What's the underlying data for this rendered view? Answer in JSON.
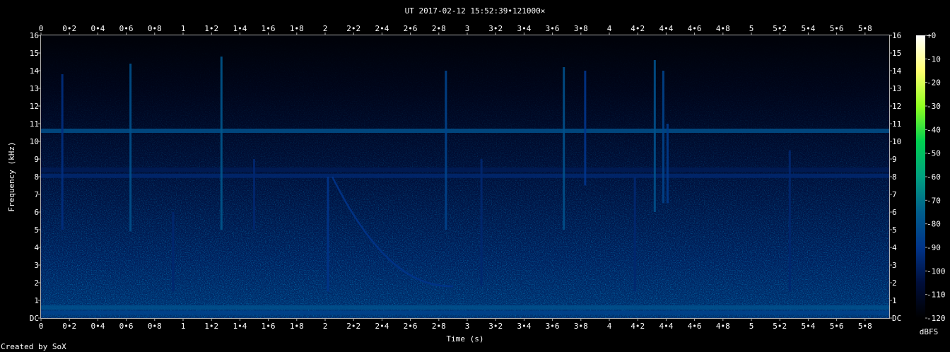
{
  "chart_data": {
    "type": "heatmap",
    "title": "UT 2017-02-12 15:52:39•121000×",
    "xlabel": "Time (s)",
    "ylabel": "Frequency (kHz)",
    "footer": "Created by SoX",
    "xlim": [
      0,
      5.97
    ],
    "ylim": [
      0,
      16
    ],
    "x_ticks": [
      {
        "v": 0,
        "label": "0"
      },
      {
        "v": 0.2,
        "label": "0•2"
      },
      {
        "v": 0.4,
        "label": "0•4"
      },
      {
        "v": 0.6,
        "label": "0•6"
      },
      {
        "v": 0.8,
        "label": "0•8"
      },
      {
        "v": 1,
        "label": "1"
      },
      {
        "v": 1.2,
        "label": "1•2"
      },
      {
        "v": 1.4,
        "label": "1•4"
      },
      {
        "v": 1.6,
        "label": "1•6"
      },
      {
        "v": 1.8,
        "label": "1•8"
      },
      {
        "v": 2,
        "label": "2"
      },
      {
        "v": 2.2,
        "label": "2•2"
      },
      {
        "v": 2.4,
        "label": "2•4"
      },
      {
        "v": 2.6,
        "label": "2•6"
      },
      {
        "v": 2.8,
        "label": "2•8"
      },
      {
        "v": 3,
        "label": "3"
      },
      {
        "v": 3.2,
        "label": "3•2"
      },
      {
        "v": 3.4,
        "label": "3•4"
      },
      {
        "v": 3.6,
        "label": "3•6"
      },
      {
        "v": 3.8,
        "label": "3•8"
      },
      {
        "v": 4,
        "label": "4"
      },
      {
        "v": 4.2,
        "label": "4•2"
      },
      {
        "v": 4.4,
        "label": "4•4"
      },
      {
        "v": 4.6,
        "label": "4•6"
      },
      {
        "v": 4.8,
        "label": "4•8"
      },
      {
        "v": 5,
        "label": "5"
      },
      {
        "v": 5.2,
        "label": "5•2"
      },
      {
        "v": 5.4,
        "label": "5•4"
      },
      {
        "v": 5.6,
        "label": "5•6"
      },
      {
        "v": 5.8,
        "label": "5•8"
      }
    ],
    "y_ticks": [
      {
        "v": 0,
        "label": "DC"
      },
      {
        "v": 1,
        "label": "1"
      },
      {
        "v": 2,
        "label": "2"
      },
      {
        "v": 3,
        "label": "3"
      },
      {
        "v": 4,
        "label": "4"
      },
      {
        "v": 5,
        "label": "5"
      },
      {
        "v": 6,
        "label": "6"
      },
      {
        "v": 7,
        "label": "7"
      },
      {
        "v": 8,
        "label": "8"
      },
      {
        "v": 9,
        "label": "9"
      },
      {
        "v": 10,
        "label": "10"
      },
      {
        "v": 11,
        "label": "11"
      },
      {
        "v": 12,
        "label": "12"
      },
      {
        "v": 13,
        "label": "13"
      },
      {
        "v": 14,
        "label": "14"
      },
      {
        "v": 15,
        "label": "15"
      },
      {
        "v": 16,
        "label": "16"
      }
    ],
    "colorbar": {
      "label": "dBFS",
      "range": [
        -120,
        0
      ],
      "ticks": [
        {
          "v": 0,
          "label": "+0"
        },
        {
          "v": -10,
          "label": "-10"
        },
        {
          "v": -20,
          "label": "-20"
        },
        {
          "v": -30,
          "label": "-30"
        },
        {
          "v": -40,
          "label": "-40"
        },
        {
          "v": -50,
          "label": "-50"
        },
        {
          "v": -60,
          "label": "-60"
        },
        {
          "v": -70,
          "label": "-70"
        },
        {
          "v": -80,
          "label": "-80"
        },
        {
          "v": -90,
          "label": "-90"
        },
        {
          "v": -100,
          "label": "-100"
        },
        {
          "v": -110,
          "label": "-110"
        },
        {
          "v": -120,
          "label": "-120"
        }
      ],
      "colors": [
        "#000000",
        "#000e3a",
        "#00348a",
        "#005e8c",
        "#00a080",
        "#00d050",
        "#90ff20",
        "#ffff70",
        "#ffffff"
      ]
    },
    "background_color": "#000f38",
    "tonal_lines": [
      {
        "freq_khz": 10.6,
        "level_dbfs": -80
      },
      {
        "freq_khz": 8.05,
        "level_dbfs": -95
      },
      {
        "freq_khz": 8.4,
        "level_dbfs": -100
      },
      {
        "freq_khz": 0.6,
        "level_dbfs": -80
      },
      {
        "freq_khz": 0.3,
        "level_dbfs": -85
      }
    ],
    "impulses": [
      {
        "t": 0.15,
        "f_lo": 5.0,
        "f_hi": 13.8,
        "level_dbfs": -92
      },
      {
        "t": 0.63,
        "f_lo": 4.9,
        "f_hi": 14.4,
        "level_dbfs": -80
      },
      {
        "t": 0.93,
        "f_lo": 1.5,
        "f_hi": 6.0,
        "level_dbfs": -95
      },
      {
        "t": 1.27,
        "f_lo": 5.0,
        "f_hi": 14.8,
        "level_dbfs": -78
      },
      {
        "t": 1.5,
        "f_lo": 5.0,
        "f_hi": 9.0,
        "level_dbfs": -95
      },
      {
        "t": 2.02,
        "f_lo": 1.5,
        "f_hi": 8.0,
        "level_dbfs": -90
      },
      {
        "t": 2.85,
        "f_lo": 5.0,
        "f_hi": 14.0,
        "level_dbfs": -85
      },
      {
        "t": 3.1,
        "f_lo": 1.8,
        "f_hi": 9.0,
        "level_dbfs": -95
      },
      {
        "t": 3.68,
        "f_lo": 5.0,
        "f_hi": 14.2,
        "level_dbfs": -80
      },
      {
        "t": 3.83,
        "f_lo": 7.5,
        "f_hi": 14.0,
        "level_dbfs": -90
      },
      {
        "t": 4.18,
        "f_lo": 1.5,
        "f_hi": 8.0,
        "level_dbfs": -95
      },
      {
        "t": 4.32,
        "f_lo": 6.0,
        "f_hi": 14.6,
        "level_dbfs": -80
      },
      {
        "t": 4.38,
        "f_lo": 6.5,
        "f_hi": 14.0,
        "level_dbfs": -85
      },
      {
        "t": 4.41,
        "f_lo": 6.5,
        "f_hi": 11.0,
        "level_dbfs": -88
      },
      {
        "t": 5.27,
        "f_lo": 1.5,
        "f_hi": 9.5,
        "level_dbfs": -95
      }
    ],
    "whistler": {
      "t_start": 2.05,
      "t_end": 2.9,
      "f_start": 8.0,
      "f_end": 1.8,
      "level_dbfs": -90
    }
  }
}
